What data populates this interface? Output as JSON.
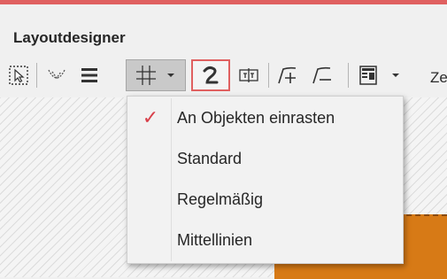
{
  "colors": {
    "accent": "#e06060",
    "check": "#d8404a",
    "orange": "#d77a16"
  },
  "window": {
    "title": "Layoutdesigner"
  },
  "toolbar": {
    "buttons": [
      {
        "icon": "selection-icon"
      },
      {
        "icon": "curve-points-icon"
      },
      {
        "icon": "lines-icon"
      },
      {
        "icon": "grid-snap-icon",
        "state": "pressed"
      },
      {
        "icon": "snap-objects-icon",
        "state": "active"
      },
      {
        "icon": "text-field-icon"
      },
      {
        "icon": "add-path-icon"
      },
      {
        "icon": "remove-path-icon"
      },
      {
        "icon": "layout-template-icon"
      }
    ],
    "overflow_text": "Ze"
  },
  "menu": {
    "items": [
      {
        "label": "An Objekten einrasten",
        "checked": true,
        "check_glyph": "✓"
      },
      {
        "label": "Standard",
        "checked": false
      },
      {
        "label": "Regelmäßig",
        "checked": false
      },
      {
        "label": "Mittellinien",
        "checked": false
      }
    ]
  }
}
